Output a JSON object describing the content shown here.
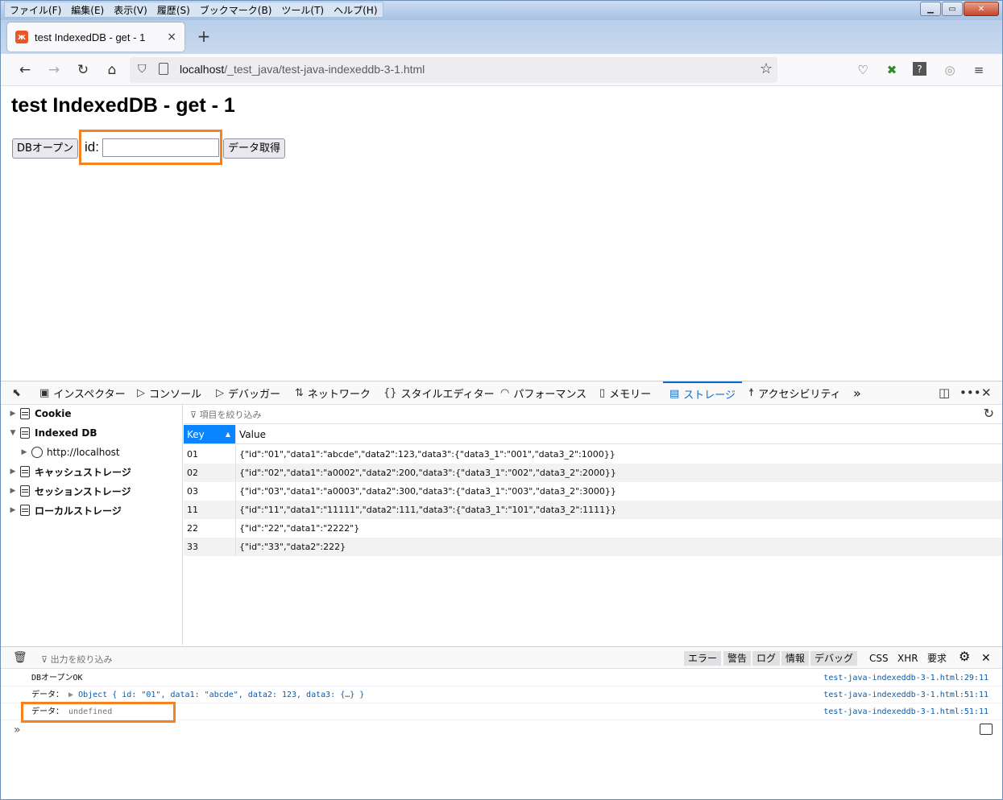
{
  "menu": [
    "ファイル(F)",
    "編集(E)",
    "表示(V)",
    "履歴(S)",
    "ブックマーク(B)",
    "ツール(T)",
    "ヘルプ(H)"
  ],
  "tab": {
    "title": "test IndexedDB - get - 1",
    "close": "×",
    "new_tab": "+"
  },
  "urlbar": {
    "host": "localhost",
    "path": "/_test_java/test-java-indexeddb-3-1.html"
  },
  "page": {
    "heading": "test IndexedDB - get - 1",
    "open_button": "DBオープン",
    "id_label": "id:",
    "id_value": "",
    "get_button": "データ取得"
  },
  "devtools": {
    "tabs": [
      "インスペクター",
      "コンソール",
      "デバッガー",
      "ネットワーク",
      "スタイルエディター",
      "パフォーマンス",
      "メモリー",
      "ストレージ",
      "アクセシビリティ"
    ],
    "active_tab": "ストレージ",
    "sidebar": [
      "Cookie",
      "Indexed DB",
      "http://localhost",
      "キャッシュストレージ",
      "セッションストレージ",
      "ローカルストレージ"
    ],
    "filter_placeholder": "項目を絞り込み",
    "columns": [
      "Key",
      "Value"
    ],
    "rows": [
      {
        "key": "01",
        "value": "{\"id\":\"01\",\"data1\":\"abcde\",\"data2\":123,\"data3\":{\"data3_1\":\"001\",\"data3_2\":1000}}"
      },
      {
        "key": "02",
        "value": "{\"id\":\"02\",\"data1\":\"a0002\",\"data2\":200,\"data3\":{\"data3_1\":\"002\",\"data3_2\":2000}}"
      },
      {
        "key": "03",
        "value": "{\"id\":\"03\",\"data1\":\"a0003\",\"data2\":300,\"data3\":{\"data3_1\":\"003\",\"data3_2\":3000}}"
      },
      {
        "key": "11",
        "value": "{\"id\":\"11\",\"data1\":\"11111\",\"data2\":111,\"data3\":{\"data3_1\":\"101\",\"data3_2\":1111}}"
      },
      {
        "key": "22",
        "value": "{\"id\":\"22\",\"data1\":\"2222\"}"
      },
      {
        "key": "33",
        "value": "{\"id\":\"33\",\"data2\":222}"
      }
    ],
    "console": {
      "filter_placeholder": "出力を絞り込み",
      "levels": [
        "エラー",
        "警告",
        "ログ",
        "情報",
        "デバッグ"
      ],
      "extra": [
        "CSS",
        "XHR",
        "要求"
      ],
      "messages": [
        {
          "text": "DBオープンOK",
          "source": "test-java-indexeddb-3-1.html:29:11"
        },
        {
          "prefix": "データ：",
          "object": "Object { id: \"01\", data1: \"abcde\", data2: 123, data3: {…} }",
          "source": "test-java-indexeddb-3-1.html:51:11"
        },
        {
          "prefix": "データ：",
          "value": "undefined",
          "source": "test-java-indexeddb-3-1.html:51:11"
        }
      ]
    }
  },
  "colors": {
    "highlight": "#f5821f",
    "accent": "#0a84ff",
    "active_tab": "#0a6bcf"
  }
}
